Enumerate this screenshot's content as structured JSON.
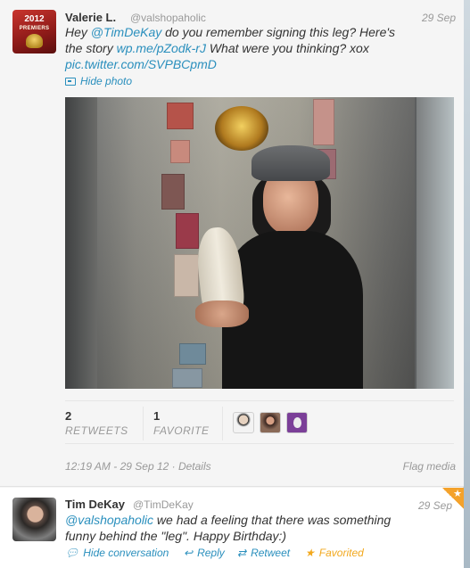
{
  "tweet1": {
    "name": "Valerie L.",
    "handle": "@valshopaholic",
    "date": "29 Sep",
    "avatar_text_year": "2012",
    "avatar_text_sub": "PREMIERS",
    "text_part1": "Hey ",
    "mention": "@TimDeKay",
    "text_part2": " do you remember signing this leg? Here's",
    "text_part3": "the story ",
    "link1": "wp.me/pZodk-rJ",
    "text_part4": " What were you thinking? xox",
    "link2": "pic.twitter.com/SVPBCpmD",
    "hide_photo_label": "Hide photo",
    "retweets_count": "2",
    "retweets_label": "RETWEETS",
    "favorites_count": "1",
    "favorites_label": "FAVORITE",
    "timestamp": "12:19 AM - 29 Sep 12 · Details",
    "flag_label": "Flag media"
  },
  "tweet2": {
    "name": "Tim DeKay",
    "handle": "@TimDeKay",
    "date": "29 Sep",
    "mention": "@valshopaholic",
    "text_part1": " we had a feeling that there was something",
    "text_part2": "funny behind the \"leg\". Happy Birthday:)",
    "hide_conversation_label": "Hide conversation",
    "reply_label": "Reply",
    "retweet_label": "Retweet",
    "favorited_label": "Favorited"
  },
  "icons": {
    "photo": "photo-icon",
    "conversation": "speech-bubble-icon",
    "reply": "reply-arrow-icon",
    "retweet": "retweet-icon",
    "favorite": "star-icon"
  },
  "colors": {
    "link": "#2a8fbd",
    "favorite": "#f2a81d"
  }
}
